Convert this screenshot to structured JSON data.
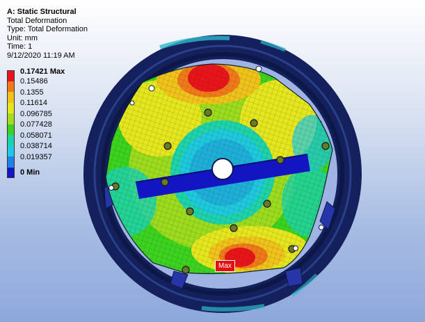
{
  "info": {
    "title": "A: Static Structural",
    "result": "Total Deformation",
    "type": "Type: Total Deformation",
    "unit": "Unit: mm",
    "time": "Time: 1",
    "date": "9/12/2020 11:19 AM"
  },
  "legend": {
    "entries": [
      {
        "label": "0.17421 Max",
        "color": "#e8141a"
      },
      {
        "label": "0.15486",
        "color": "#f07a1a"
      },
      {
        "label": "0.1355",
        "color": "#f0c21a"
      },
      {
        "label": "0.11614",
        "color": "#e6e61e"
      },
      {
        "label": "0.096785",
        "color": "#a6dc1e"
      },
      {
        "label": "0.077428",
        "color": "#3cd21e"
      },
      {
        "label": "0.058071",
        "color": "#1ed2aa"
      },
      {
        "label": "0.038714",
        "color": "#1ec8e6"
      },
      {
        "label": "0.019357",
        "color": "#1e82e6"
      },
      {
        "label": "0 Min",
        "color": "#1414c8"
      }
    ]
  },
  "probe": {
    "max_label": "Max"
  }
}
